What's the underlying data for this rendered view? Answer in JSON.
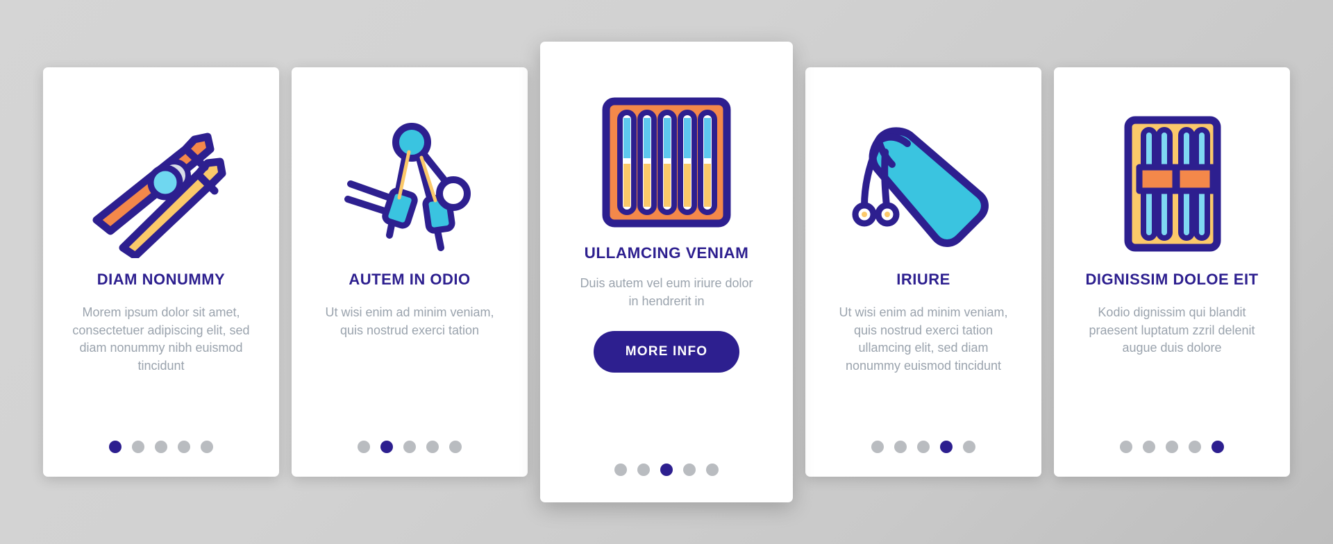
{
  "theme": {
    "accent": "#2d1f8f",
    "title_color": "#2d1f8f",
    "body_color": "#9aa3ad",
    "dot_inactive": "#b9bcc0",
    "card_bg": "#ffffff",
    "page_bg": "#d0d0d0",
    "icon_orange": "#f4884a",
    "icon_yellow": "#fbc96a",
    "icon_cyan": "#3ac4e0",
    "icon_lightblue": "#7fd8f2",
    "icon_outline": "#2d1f8f"
  },
  "cards": [
    {
      "icon_name": "chopsticks-pair-icon",
      "title": "DIAM NONUMMY",
      "body": "Morem ipsum dolor sit amet, consectetuer adipiscing elit, sed diam nonummy nibh euismod tincidunt",
      "dots": {
        "count": 5,
        "active_index": 0
      },
      "featured": false
    },
    {
      "icon_name": "chopsticks-helper-icon",
      "title": "AUTEM IN ODIO",
      "body": "Ut wisi enim ad minim veniam, quis nostrud exerci tation",
      "dots": {
        "count": 5,
        "active_index": 1
      },
      "featured": false
    },
    {
      "icon_name": "chopsticks-box-set-icon",
      "title": "ULLAMCING VENIAM",
      "body": "Duis autem vel eum iriure dolor in hendrerit in",
      "button_label": "MORE INFO",
      "dots": {
        "count": 5,
        "active_index": 2
      },
      "featured": true
    },
    {
      "icon_name": "chopsticks-pouch-icon",
      "title": "IRIURE",
      "body": "Ut wisi enim ad minim veniam, quis nostrud exerci tation ullamcing elit, sed diam nonummy euismod tincidunt",
      "dots": {
        "count": 5,
        "active_index": 3
      },
      "featured": false
    },
    {
      "icon_name": "chopsticks-case-icon",
      "title": "DIGNISSIM DOLOE EIT",
      "body": "Kodio dignissim qui blandit praesent luptatum zzril delenit augue duis dolore",
      "dots": {
        "count": 5,
        "active_index": 4
      },
      "featured": false
    }
  ]
}
